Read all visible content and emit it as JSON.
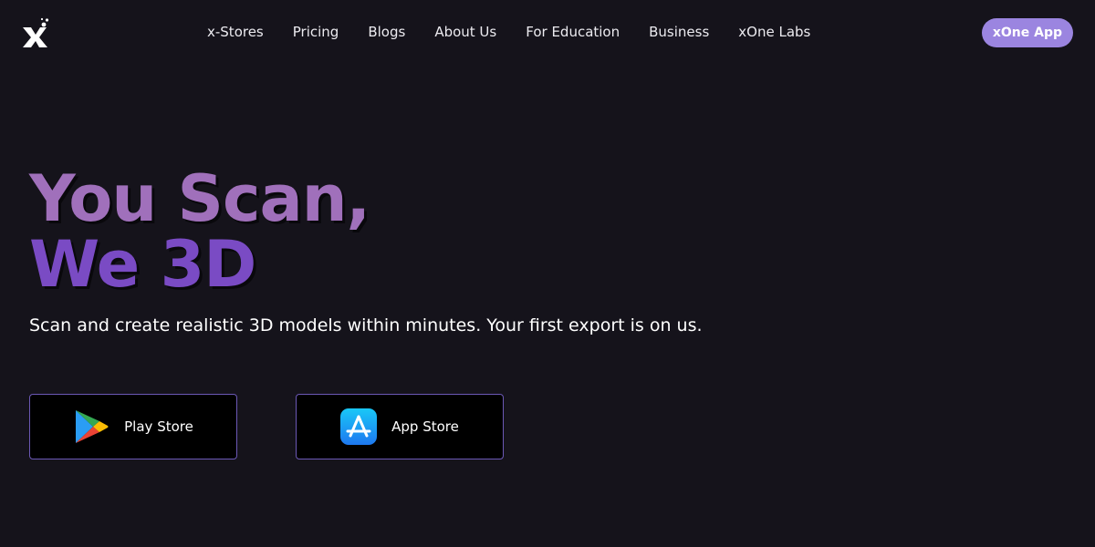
{
  "header": {
    "logo_icon": "xone-logo-icon",
    "nav": [
      {
        "label": "x-Stores"
      },
      {
        "label": "Pricing"
      },
      {
        "label": "Blogs"
      },
      {
        "label": "About Us"
      },
      {
        "label": "For Education"
      },
      {
        "label": "Business"
      },
      {
        "label": "xOne Labs"
      }
    ],
    "cta_label": "xOne App"
  },
  "hero": {
    "title_line1": "You Scan,",
    "title_line2": "We 3D",
    "subtitle": "Scan and create realistic 3D models within minutes. Your first export is on us."
  },
  "stores": {
    "play": {
      "label": "Play Store",
      "icon": "google-play-icon"
    },
    "apple": {
      "label": "App Store",
      "icon": "app-store-icon"
    }
  },
  "colors": {
    "background": "#15131b",
    "accent": "#9b85e0",
    "title_gradient_top": "#a070bb",
    "title_gradient_bottom": "#7a4bc4",
    "store_border": "#6b58b5"
  }
}
